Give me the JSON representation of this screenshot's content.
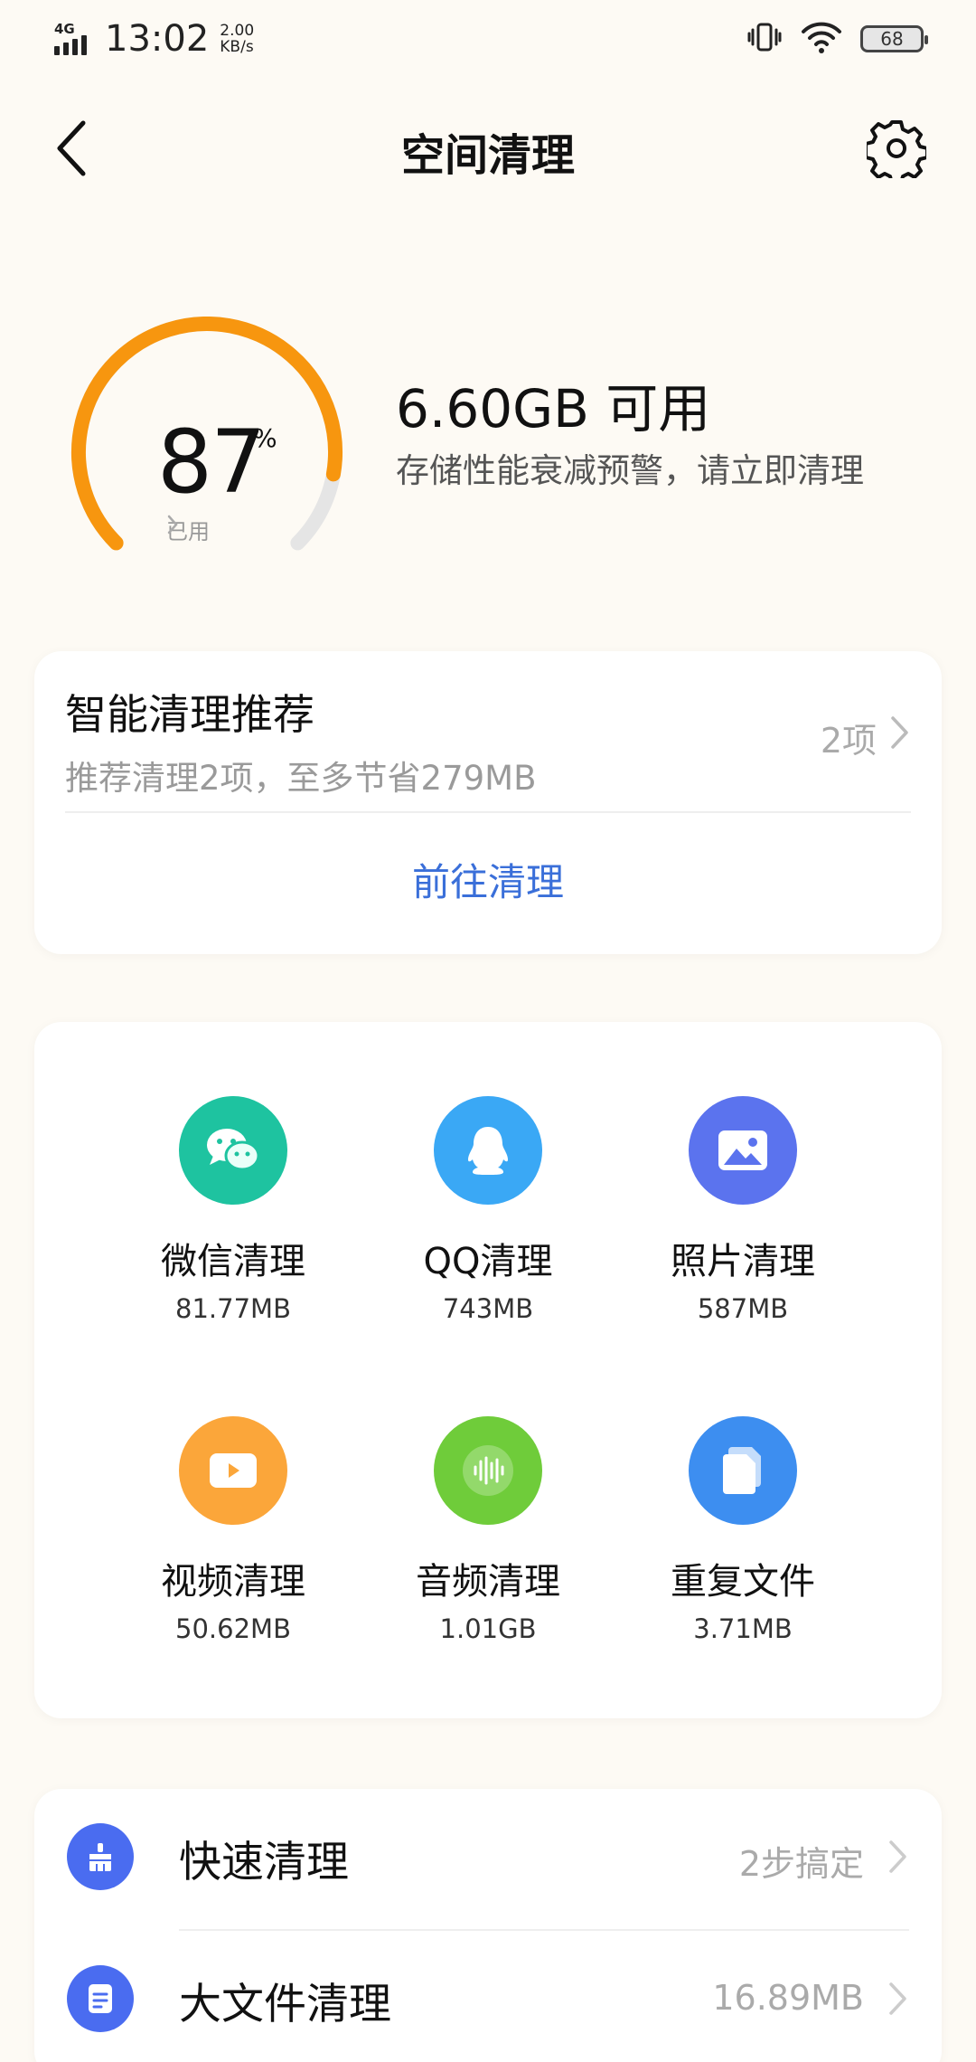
{
  "status_bar": {
    "network": "4G",
    "time": "13:02",
    "speed_value": "2.00",
    "speed_unit": "KB/s",
    "battery": "68"
  },
  "header": {
    "title": "空间清理",
    "back_icon": "chevron-left-icon",
    "settings_icon": "gear-icon"
  },
  "storage": {
    "used_percent": 87,
    "used_percent_text": "87",
    "percent_unit": "%",
    "used_label": "已用",
    "available": "6.60GB 可用",
    "warning": "存储性能衰减预警，请立即清理",
    "gauge_color": "#f7960f",
    "gauge_track_color": "#e5e5e5"
  },
  "smart_clean": {
    "title": "智能清理推荐",
    "subtitle": "推荐清理2项，至多节省279MB",
    "count": "2项",
    "action": "前往清理",
    "action_color": "#3a6fd9"
  },
  "categories": [
    {
      "label": "微信清理",
      "size": "81.77MB",
      "icon": "wechat-icon",
      "color": "#1ec3a0"
    },
    {
      "label": "QQ清理",
      "size": "743MB",
      "icon": "qq-penguin-icon",
      "color": "#3aa8f5"
    },
    {
      "label": "照片清理",
      "size": "587MB",
      "icon": "photo-icon",
      "color": "#5b73ee"
    },
    {
      "label": "视频清理",
      "size": "50.62MB",
      "icon": "video-play-icon",
      "color": "#fba63a"
    },
    {
      "label": "音频清理",
      "size": "1.01GB",
      "icon": "audio-wave-icon",
      "color": "#6fcc3a"
    },
    {
      "label": "重复文件",
      "size": "3.71MB",
      "icon": "duplicate-file-icon",
      "color": "#3d8ef0"
    }
  ],
  "tools": [
    {
      "label": "快速清理",
      "value": "2步搞定",
      "icon": "broom-icon"
    },
    {
      "label": "大文件清理",
      "value": "16.89MB",
      "icon": "document-icon"
    }
  ]
}
